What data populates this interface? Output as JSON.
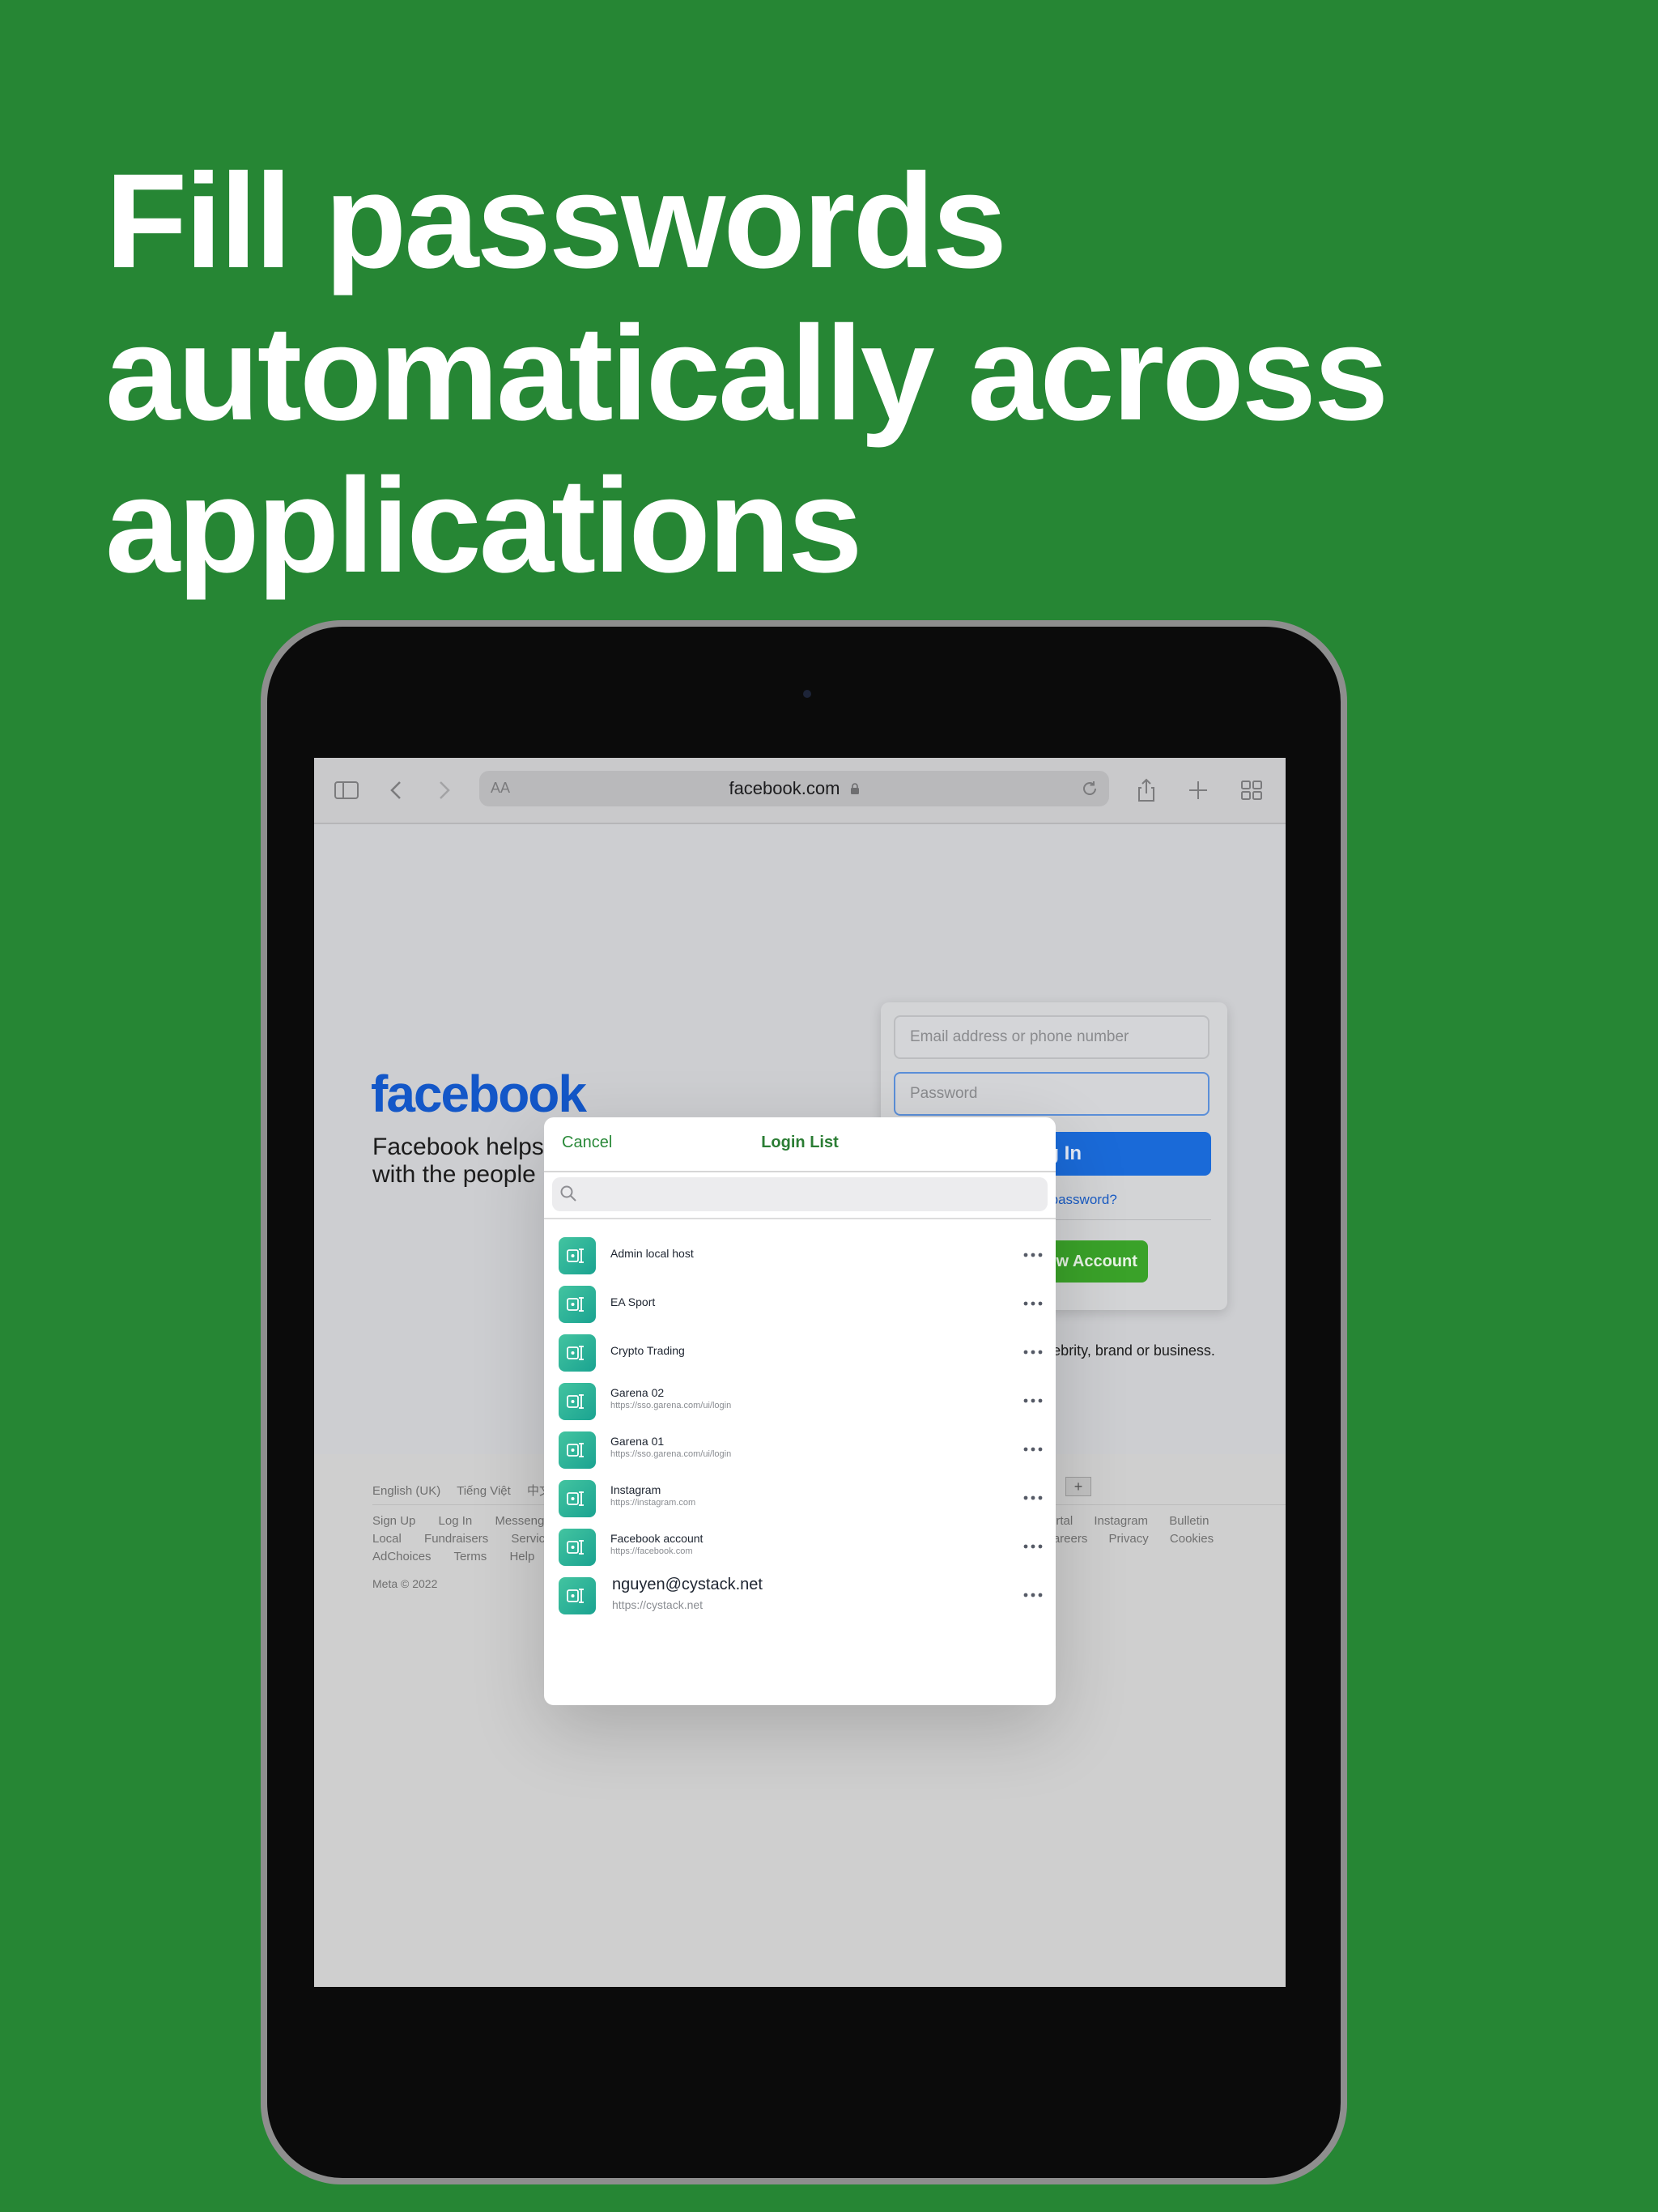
{
  "headline": {
    "line1": "Fill passwords",
    "line2": "automatically across",
    "line3": "applications"
  },
  "browser": {
    "aa_label": "AA",
    "url": "facebook.com",
    "icons": [
      "sidebar-icon",
      "back-icon",
      "forward-icon",
      "lock-icon",
      "reload-icon",
      "share-icon",
      "plus-icon",
      "tabs-icon"
    ]
  },
  "facebook": {
    "logo": "facebook",
    "tagline": "Facebook helps you connect and share with the people in your life.",
    "email_placeholder": "Email address or phone number",
    "password_placeholder": "Password",
    "login_button": "Log In",
    "forgot_password": "Forgotten password?",
    "create_account": "Create New Account",
    "create_page_text": "Create a Page for a celebrity, brand or business."
  },
  "footer": {
    "languages": [
      "English (UK)",
      "Tiếng Việt",
      "中文(台灣)"
    ],
    "links_row1": [
      "Sign Up",
      "Log In",
      "Messenger"
    ],
    "links_row1_right": [
      "Portal",
      "Instagram",
      "Bulletin"
    ],
    "links_row2": [
      "Local",
      "Fundraisers",
      "Services"
    ],
    "links_row2_right": [
      "Careers",
      "Privacy",
      "Cookies"
    ],
    "links_row3": [
      "AdChoices",
      "Terms",
      "Help"
    ],
    "meta": "Meta © 2022"
  },
  "modal": {
    "cancel": "Cancel",
    "title": "Login List",
    "search_placeholder": "",
    "items": [
      {
        "title": "Admin local host",
        "url": ""
      },
      {
        "title": "EA Sport",
        "url": ""
      },
      {
        "title": "Crypto Trading",
        "url": ""
      },
      {
        "title": "Garena 02",
        "url": "https://sso.garena.com/ui/login"
      },
      {
        "title": "Garena 01",
        "url": "https://sso.garena.com/ui/login"
      },
      {
        "title": "Instagram",
        "url": "https://instagram.com"
      },
      {
        "title": "Facebook account",
        "url": "https://facebook.com"
      },
      {
        "title": "nguyen@cystack.net",
        "url": "https://cystack.net"
      }
    ]
  },
  "colors": {
    "background": "#268634",
    "accent_green": "#2b8a3a",
    "facebook_blue": "#1357c8",
    "item_icon": "#1aa391"
  }
}
